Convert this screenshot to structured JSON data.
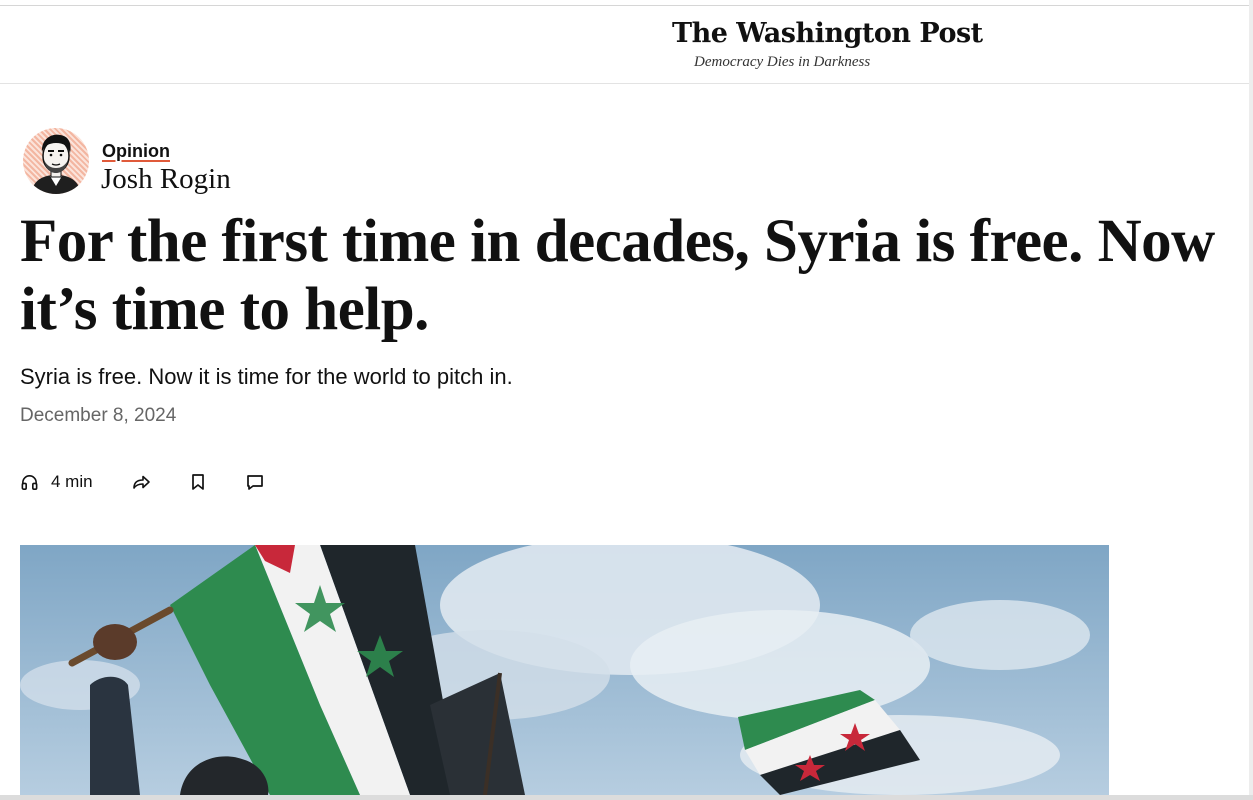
{
  "masthead": {
    "logo": "The Washington Post",
    "tagline": "Democracy Dies in Darkness"
  },
  "byline": {
    "section": "Opinion",
    "author": "Josh Rogin",
    "avatar_icon": "author-portrait-illustration"
  },
  "article": {
    "headline": "For the first time in decades, Syria is free. Now it’s time to help.",
    "dek": "Syria is free. Now it is time for the world to pitch in.",
    "date": "December 8, 2024"
  },
  "toolbar": {
    "listen_icon": "headphones-icon",
    "listen_label": "4 min",
    "share_icon": "share-arrow-icon",
    "save_icon": "bookmark-icon",
    "comment_icon": "comment-icon"
  },
  "hero_image": {
    "subject": "protester-waving-syrian-independence-flag"
  },
  "colors": {
    "accent_underline": "#e05a3a",
    "text": "#111111",
    "muted": "#666666",
    "flag_green": "#2e8b4f",
    "flag_red": "#c8283a",
    "sky": "#8fb3cf"
  }
}
